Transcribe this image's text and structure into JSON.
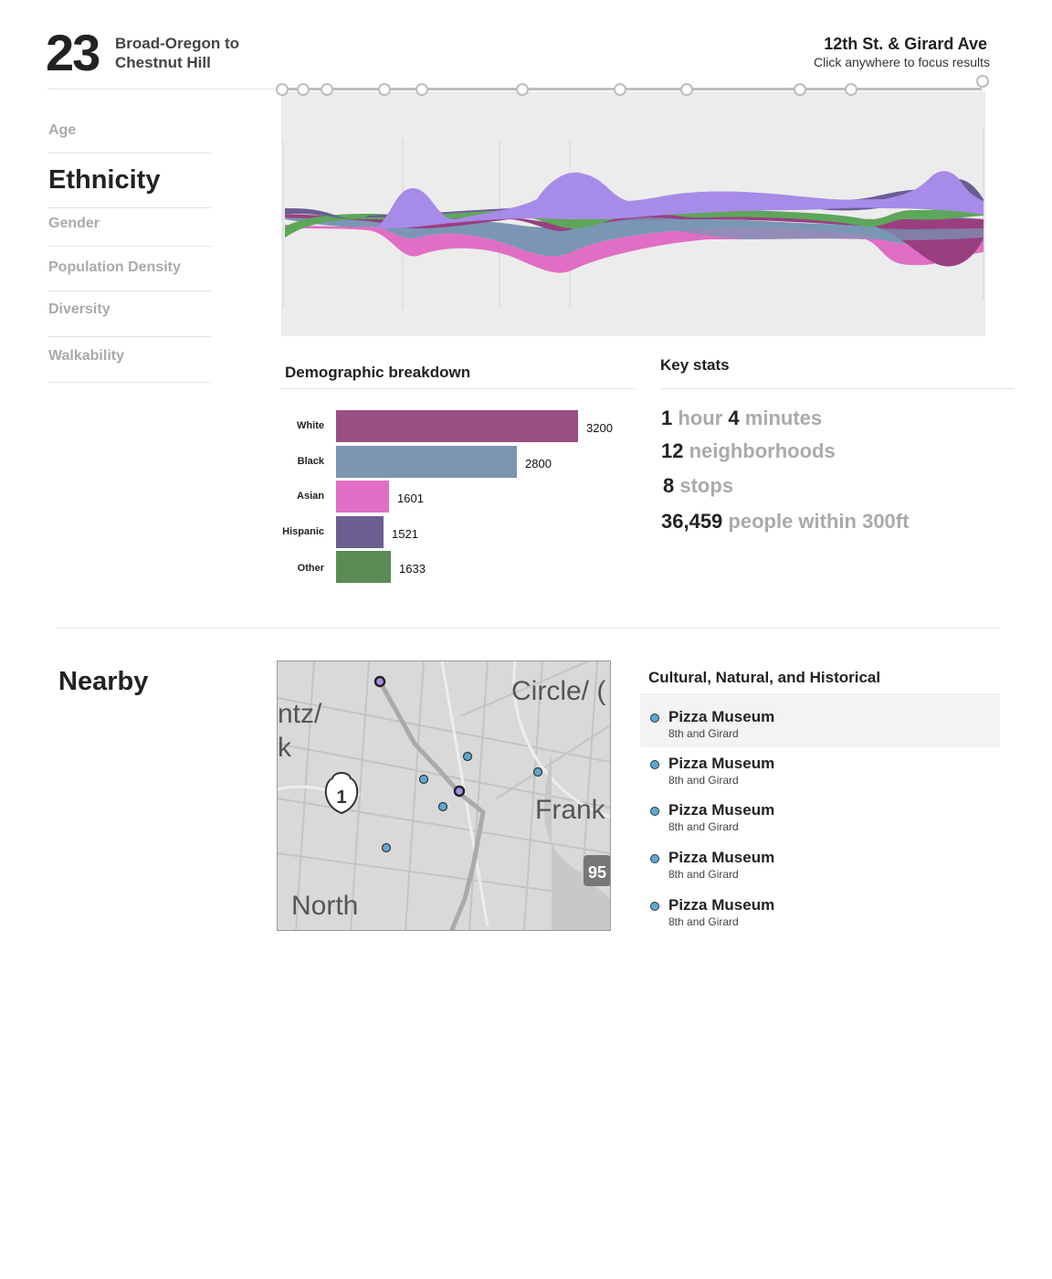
{
  "route": {
    "number": "23",
    "name_line1": "Broad-Oregon to",
    "name_line2": "Chestnut Hill"
  },
  "stop": {
    "name": "12th St. & Girard Ave",
    "hint": "Click anywhere to focus results"
  },
  "sidebar": {
    "items": [
      {
        "label": "Age",
        "active": false
      },
      {
        "label": "Ethnicity",
        "active": true
      },
      {
        "label": "Gender",
        "active": false
      },
      {
        "label": "Population Density",
        "active": false
      },
      {
        "label": "Diversity",
        "active": false
      },
      {
        "label": "Walkability",
        "active": false
      }
    ]
  },
  "stream_chart": {
    "type": "area",
    "series_colors": [
      "#a78be8",
      "#6b5d94",
      "#7a96b4",
      "#993f80",
      "#5ea65a",
      "#e06ec4"
    ],
    "background": "#ececec"
  },
  "demographics": {
    "title": "Demographic breakdown",
    "chart_data": {
      "type": "bar",
      "categories": [
        "White",
        "Black",
        "Asian",
        "Hispanic",
        "Other"
      ],
      "values": [
        3200,
        2800,
        1601,
        1521,
        1633
      ],
      "colors": [
        "#994f82",
        "#7c95b0",
        "#e06ec4",
        "#6b5f8f",
        "#5b8c55"
      ]
    }
  },
  "key_stats": {
    "title": "Key stats",
    "travel_hours": "1",
    "hour_word": "hour",
    "travel_minutes": "4",
    "minute_word": "minutes",
    "neighborhoods": "12",
    "neighborhoods_word": "neighborhoods",
    "stops": "8",
    "stops_word": "stops",
    "people": "36,459",
    "people_word": "people within 300ft"
  },
  "nearby": {
    "title": "Nearby",
    "map_labels": {
      "circle": "Circle/ (",
      "frank": "Frank",
      "north": "North",
      "ntz": "ntz/",
      "k": "k",
      "shield": "1",
      "shield2": "95"
    },
    "category": "Cultural, Natural, and Historical",
    "places": [
      {
        "name": "Pizza Museum",
        "address": "8th and Girard"
      },
      {
        "name": "Pizza Museum",
        "address": "8th and Girard"
      },
      {
        "name": "Pizza Museum",
        "address": "8th and Girard"
      },
      {
        "name": "Pizza Museum",
        "address": "8th and Girard"
      },
      {
        "name": "Pizza Museum",
        "address": "8th and Girard"
      }
    ]
  }
}
